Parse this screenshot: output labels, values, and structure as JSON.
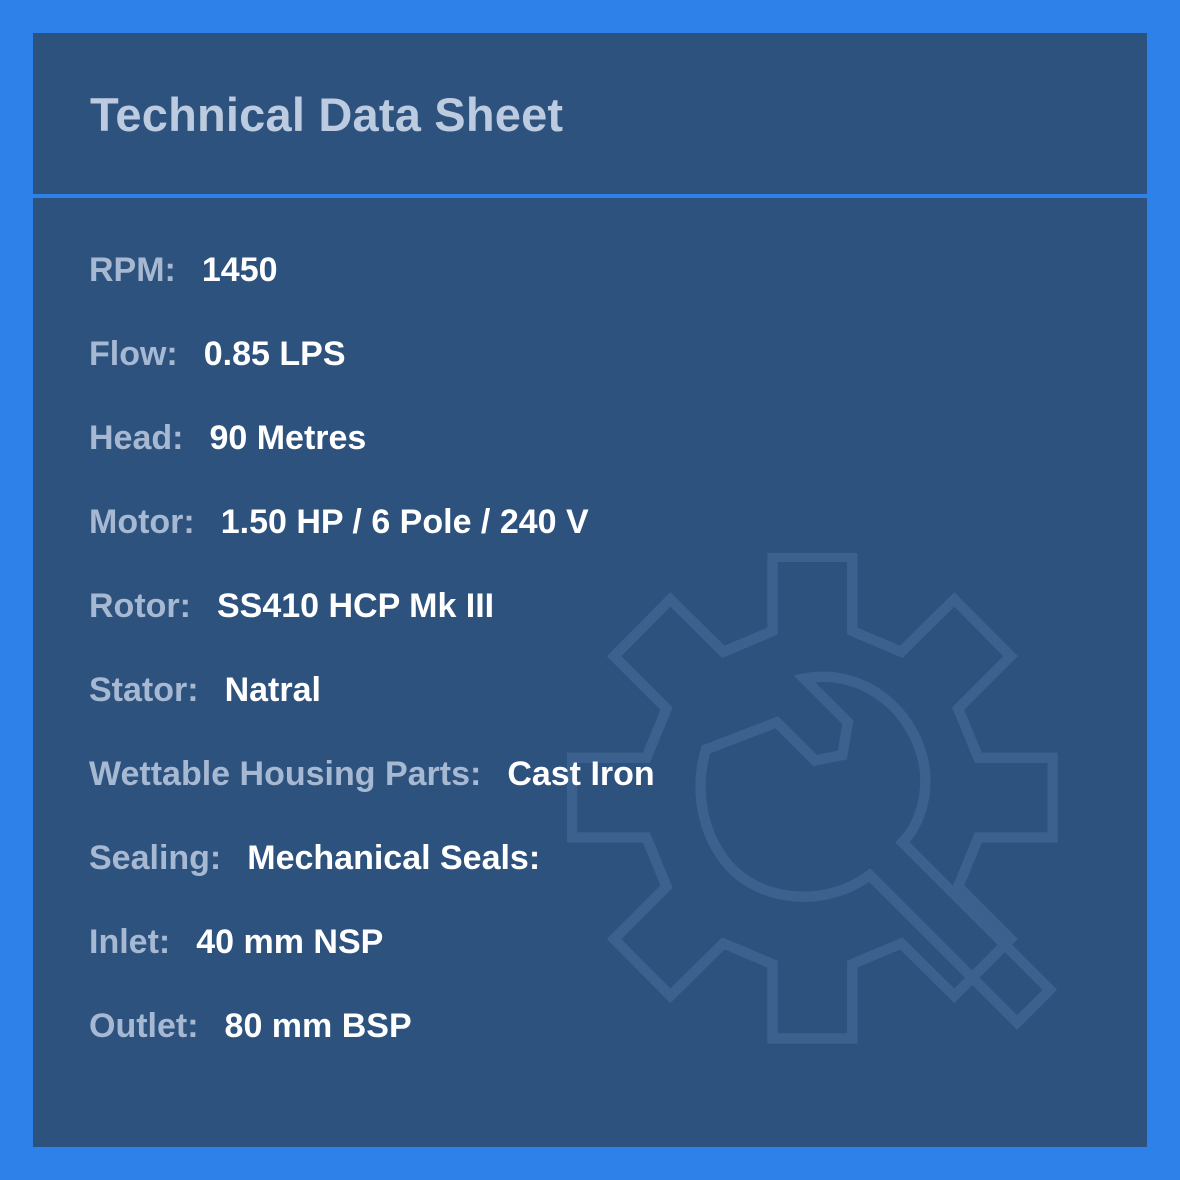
{
  "title": "Technical Data Sheet",
  "background_icon": "gear-wrench-icon",
  "colors": {
    "frame": "#2f81ea",
    "panel": "#2d527e",
    "label": "#a7b9d2",
    "value": "#ffffff",
    "title": "#bccbe0"
  },
  "specs": [
    {
      "label": "RPM:",
      "value": "1450"
    },
    {
      "label": "Flow:",
      "value": "0.85 LPS"
    },
    {
      "label": "Head:",
      "value": "90 Metres"
    },
    {
      "label": "Motor:",
      "value": "1.50 HP / 6 Pole / 240 V"
    },
    {
      "label": "Rotor:",
      "value": "SS410 HCP Mk III"
    },
    {
      "label": "Stator:",
      "value": "Natral"
    },
    {
      "label": "Wettable Housing Parts:",
      "value": "Cast Iron"
    },
    {
      "label": "Sealing:",
      "value": "Mechanical Seals:"
    },
    {
      "label": "Inlet:",
      "value": "40 mm NSP"
    },
    {
      "label": "Outlet:",
      "value": "80 mm BSP"
    }
  ]
}
